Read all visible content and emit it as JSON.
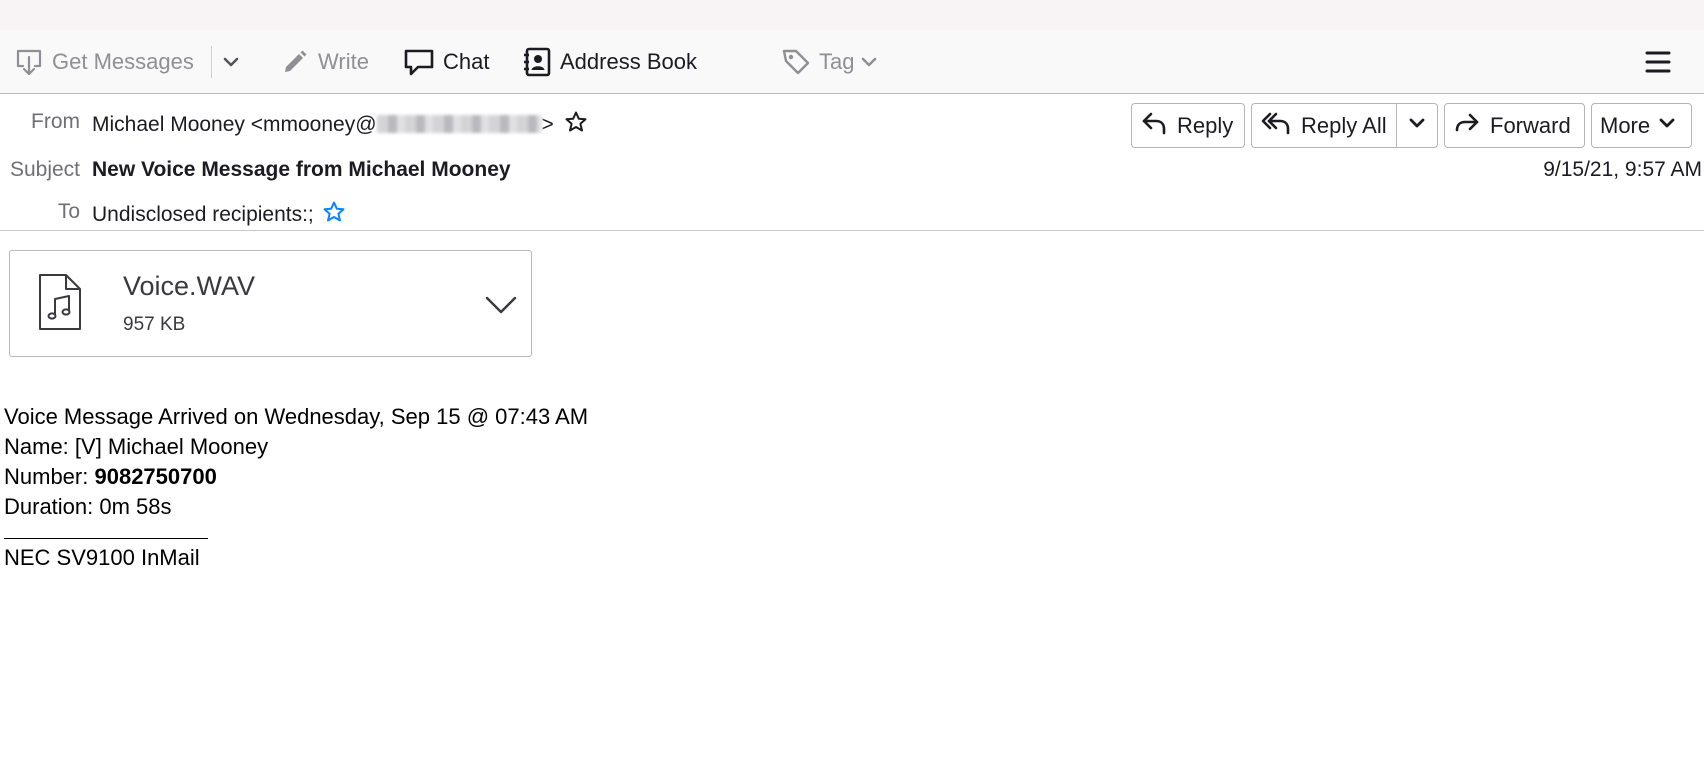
{
  "toolbar": {
    "get_messages": "Get Messages",
    "write": "Write",
    "chat": "Chat",
    "address_book": "Address Book",
    "tag": "Tag"
  },
  "header": {
    "from_label": "From",
    "from_value": "Michael Mooney <mmooney@",
    "from_close": ">",
    "subject_label": "Subject",
    "subject_value": "New Voice Message from Michael Mooney",
    "to_label": "To",
    "to_value": "Undisclosed recipients:;",
    "date": "9/15/21, 9:57 AM",
    "buttons": {
      "reply": "Reply",
      "reply_all": "Reply All",
      "forward": "Forward",
      "more": "More"
    }
  },
  "attachment": {
    "name": "Voice.WAV",
    "size": "957 KB"
  },
  "body": {
    "line1": "Voice Message Arrived on Wednesday, Sep 15 @ 07:43 AM",
    "line2": "Name: [V] Michael Mooney",
    "number_label": "Number: ",
    "number_value": "9082750700",
    "line4": "Duration: 0m 58s",
    "signature": "NEC SV9100 InMail"
  },
  "colors": {
    "star_accent": "#0a84ff",
    "toolbar_bg": "#f9f9fa",
    "top_strip": "#f8f3f5"
  }
}
